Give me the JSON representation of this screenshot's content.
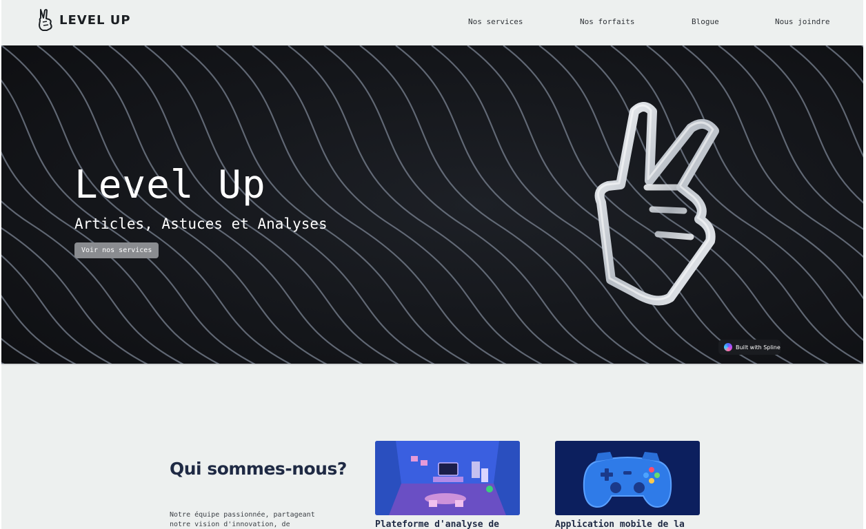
{
  "header": {
    "logo_text": "LEVEL UP",
    "nav": [
      "Nos services",
      "Nos forfaits",
      "Blogue",
      "Nous joindre"
    ]
  },
  "hero": {
    "title": "Level Up",
    "subtitle": "Articles, Astuces et Analyses",
    "button_label": "Voir nos services",
    "badge_label": "Built with Spline"
  },
  "about": {
    "title": "Qui sommes-nous?",
    "text": "Notre équipe passionnée, partageant notre vision d'innovation, de"
  },
  "cards": [
    {
      "title": "Plateforme d'analyse de",
      "icon": "gaming-room-illustration"
    },
    {
      "title": "Application mobile de la",
      "icon": "gamepad-illustration"
    }
  ],
  "colors": {
    "page_bg": "#edf0ef",
    "hero_bg": "#16181c",
    "heading": "#1f2a44",
    "button_bg": "#8a8c90"
  }
}
